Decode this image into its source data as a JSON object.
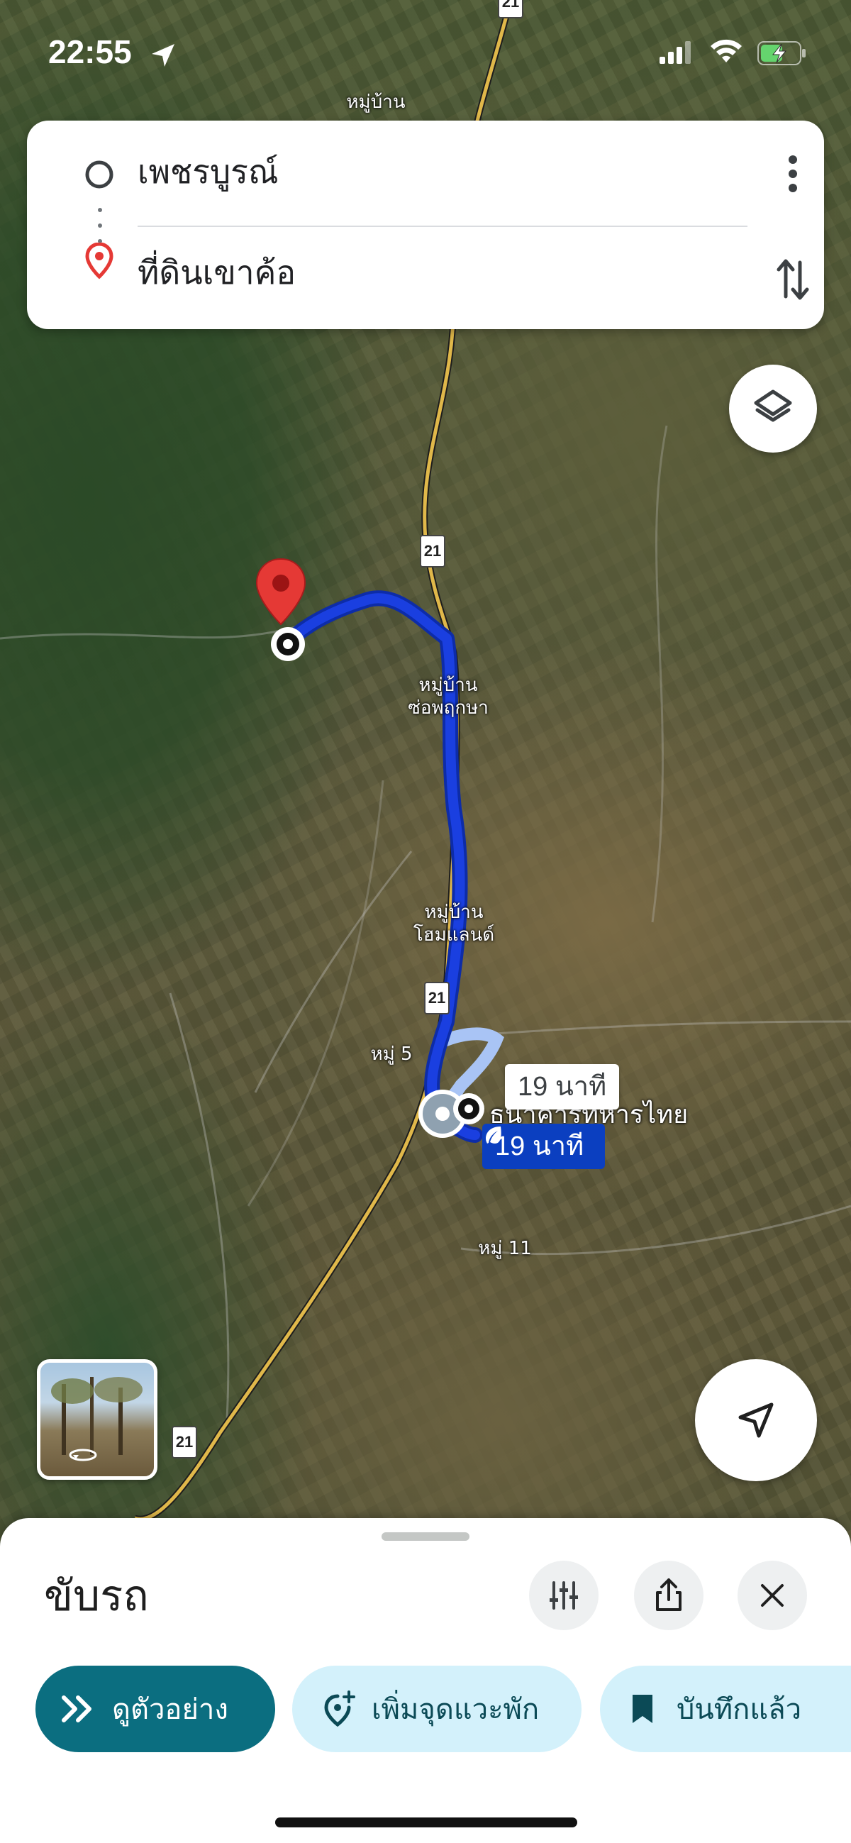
{
  "status_bar": {
    "time": "22:55"
  },
  "search": {
    "origin": "เพชรบูรณ์",
    "destination": "ที่ดินเขาค้อ"
  },
  "map": {
    "labels": [
      {
        "text": "หมู่บ้าน"
      },
      {
        "text": "หมู่บ้าน\nซ่อพฤกษา"
      },
      {
        "text": "หมู่บ้าน\nโฮมแลนด์"
      },
      {
        "text": "หมู่ 5"
      },
      {
        "text": "หมู่ 11"
      },
      {
        "text": "ธนาคารทหารไทย"
      }
    ],
    "highway_shields": [
      "21",
      "21",
      "21",
      "21"
    ],
    "route_alt_time": "19 นาที",
    "route_main_time": "19 นาที",
    "route_color": "#1a3fe0",
    "route_alt_color": "#a9c4f5"
  },
  "bottom_sheet": {
    "title": "ขับรถ",
    "actions": {
      "preview": "ดูตัวอย่าง",
      "add_stop": "เพิ่มจุดแวะพัก",
      "saved": "บันทึกแล้ว"
    }
  },
  "colors": {
    "accent_teal": "#0b6e80",
    "chip_light": "#d3f1fb",
    "pin_red": "#e53935"
  }
}
